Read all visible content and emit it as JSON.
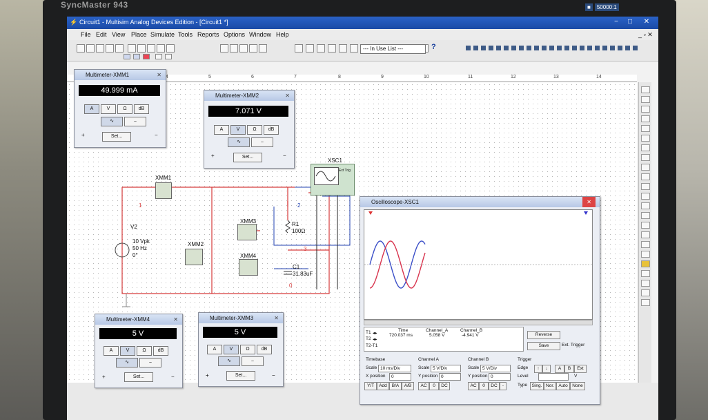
{
  "monitor": {
    "brand": "SyncMaster 943",
    "contrast": "50000:1"
  },
  "app": {
    "title": "Circuit1 - Multisim Analog Devices Edition - [Circuit1 *]",
    "menu": [
      "File",
      "Edit",
      "View",
      "Place",
      "Simulate",
      "Tools",
      "Reports",
      "Options",
      "Window",
      "Help"
    ],
    "in_use_list": "--- In Use List ---",
    "help_glyph": "?"
  },
  "ruler": [
    "4",
    "5",
    "6",
    "7",
    "8",
    "9",
    "10",
    "11",
    "12",
    "13",
    "14"
  ],
  "circuit": {
    "source_name": "V2",
    "source_value": "10 Vpk",
    "source_freq": "50 Hz",
    "source_phase": "0°",
    "r1_name": "R1",
    "r1_value": "100Ω",
    "c1_name": "C1",
    "c1_value": "31.83uF",
    "xsc1": "XSC1",
    "xmm1": "XMM1",
    "xmm2": "XMM2",
    "xmm3": "XMM3",
    "xmm4": "XMM4",
    "net1": "1",
    "net2": "2",
    "net3": "3",
    "net0": "0",
    "ext_trig": "Ext Trig"
  },
  "multimeters": [
    {
      "title": "Multimeter-XMM1",
      "reading": "49.999 mA",
      "mode": "A"
    },
    {
      "title": "Multimeter-XMM2",
      "reading": "7.071 V",
      "mode": "V"
    },
    {
      "title": "Multimeter-XMM4",
      "reading": "5 V",
      "mode": "V"
    },
    {
      "title": "Multimeter-XMM3",
      "reading": "5 V",
      "mode": "V"
    }
  ],
  "multimeter_labels": {
    "a": "A",
    "v": "V",
    "ohm": "Ω",
    "db": "dB",
    "set": "Set...",
    "plus": "+",
    "minus": "−"
  },
  "oscilloscope": {
    "title": "Oscilloscope-XSC1",
    "time_header": "Time",
    "cha_header": "Channel_A",
    "chb_header": "Channel_B",
    "t1": "T1",
    "t2": "T2",
    "t2t1": "T2-T1",
    "time_value": "720.037 ms",
    "cha_value": "5.058 V",
    "chb_value": "-4.941 V",
    "reverse": "Reverse",
    "save": "Save",
    "ext_trigger": "Ext. Trigger",
    "timebase_label": "Timebase",
    "scale_label": "Scale",
    "timebase_scale": "10 ms/Div",
    "x_position_label": "X position",
    "x_position": "0",
    "yt": "Y/T",
    "add": "Add",
    "ba": "B/A",
    "ab": "A/B",
    "channel_a_label": "Channel A",
    "channel_a_scale": "5 V/Div",
    "y_position_label": "Y position",
    "channel_a_ypos": "0",
    "channel_b_label": "Channel B",
    "channel_b_scale": "5 V/Div",
    "channel_b_ypos": "0",
    "ac": "AC",
    "zero": "0",
    "dc": "DC",
    "trigger_label": "Trigger",
    "edge_label": "Edge",
    "level_label": "Level",
    "level_unit": "V",
    "type_label": "Type",
    "sing": "Sing.",
    "nor": "Nor.",
    "auto": "Auto",
    "none": "None",
    "trig_a": "A",
    "trig_b": "B",
    "trig_ext": "Ext"
  },
  "colors": {
    "wire": "#d63a3a",
    "channel_a": "#3b4fc8",
    "channel_b": "#d8344e",
    "titlebar": "#1a4aa6"
  }
}
